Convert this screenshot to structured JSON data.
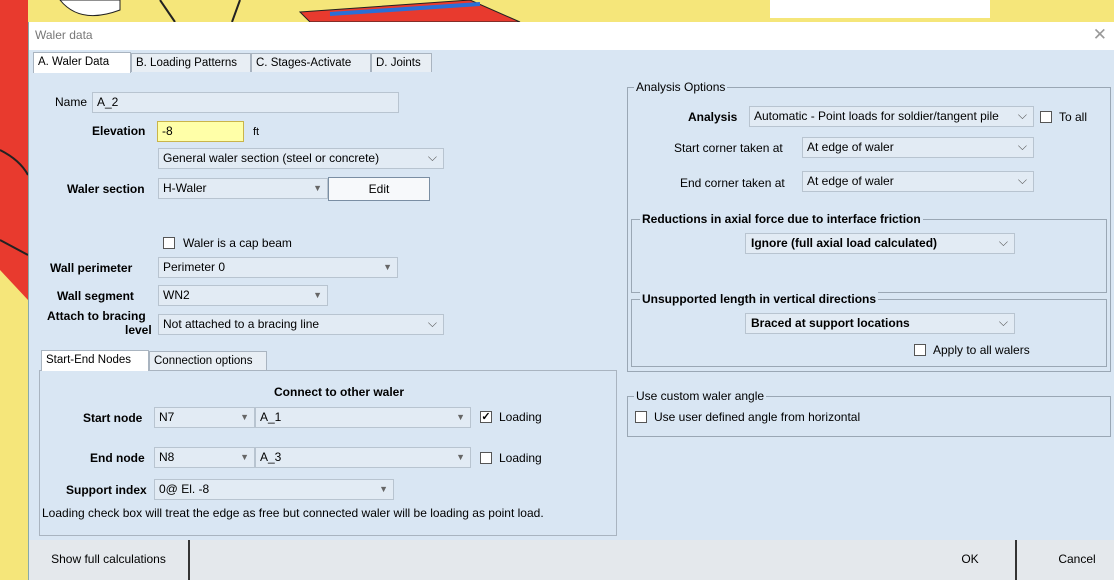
{
  "window": {
    "title": "Waler data"
  },
  "tabs": [
    {
      "label": "A. Waler Data"
    },
    {
      "label": "B. Loading Patterns"
    },
    {
      "label": "C. Stages-Activate"
    },
    {
      "label": "D. Joints"
    }
  ],
  "waler": {
    "name_label": "Name",
    "name_value": "A_2",
    "elevation_label": "Elevation",
    "elevation_value": "-8",
    "elevation_unit": "ft",
    "section_type": "General waler section (steel or concrete)",
    "section_label": "Waler section",
    "section_value": "H-Waler",
    "edit_label": "Edit",
    "cap_beam_label": "Waler is a cap beam",
    "perimeter_label": "Wall perimeter",
    "perimeter_value": "Perimeter 0",
    "segment_label": "Wall segment",
    "segment_value": "WN2",
    "attach_label_1": "Attach to bracing",
    "attach_label_2": "level",
    "attach_value": "Not attached to a bracing line"
  },
  "subtabs": [
    {
      "label": "Start-End Nodes"
    },
    {
      "label": "Connection options"
    }
  ],
  "nodes": {
    "connect_header": "Connect to other waler",
    "start_label": "Start node",
    "start_node": "N7",
    "start_waler": "A_1",
    "start_loading_label": "Loading",
    "start_loading_checked": true,
    "end_label": "End node",
    "end_node": "N8",
    "end_waler": "A_3",
    "end_loading_label": "Loading",
    "end_loading_checked": false,
    "support_label": "Support index",
    "support_value": "0@ El. -8",
    "note": "Loading check box will treat the edge as free but connected waler will be loading as point load."
  },
  "analysis": {
    "group_title": "Analysis Options",
    "analysis_label": "Analysis",
    "analysis_value": "Automatic - Point loads for soldier/tangent pile",
    "to_all_label": "To all",
    "start_corner_label": "Start corner taken at",
    "start_corner_value": "At edge of waler",
    "end_corner_label": "End corner taken at",
    "end_corner_value": "At edge of waler",
    "reductions_title": "Reductions in axial force due to interface friction",
    "reductions_value": "Ignore (full axial load calculated)",
    "unsupported_title": "Unsupported length in vertical directions",
    "unsupported_value": "Braced at support locations",
    "apply_all_label": "Apply to all walers"
  },
  "custom_angle": {
    "group_title": "Use custom waler angle",
    "checkbox_label": "Use user defined angle from horizontal"
  },
  "footer": {
    "show_calc_label": "Show full calculations",
    "ok_label": "OK",
    "cancel_label": "Cancel"
  },
  "colors": {
    "elevation_highlight": "#ffffa8",
    "dialog_bg": "#d9e6f3",
    "background": "#f5e67a"
  }
}
